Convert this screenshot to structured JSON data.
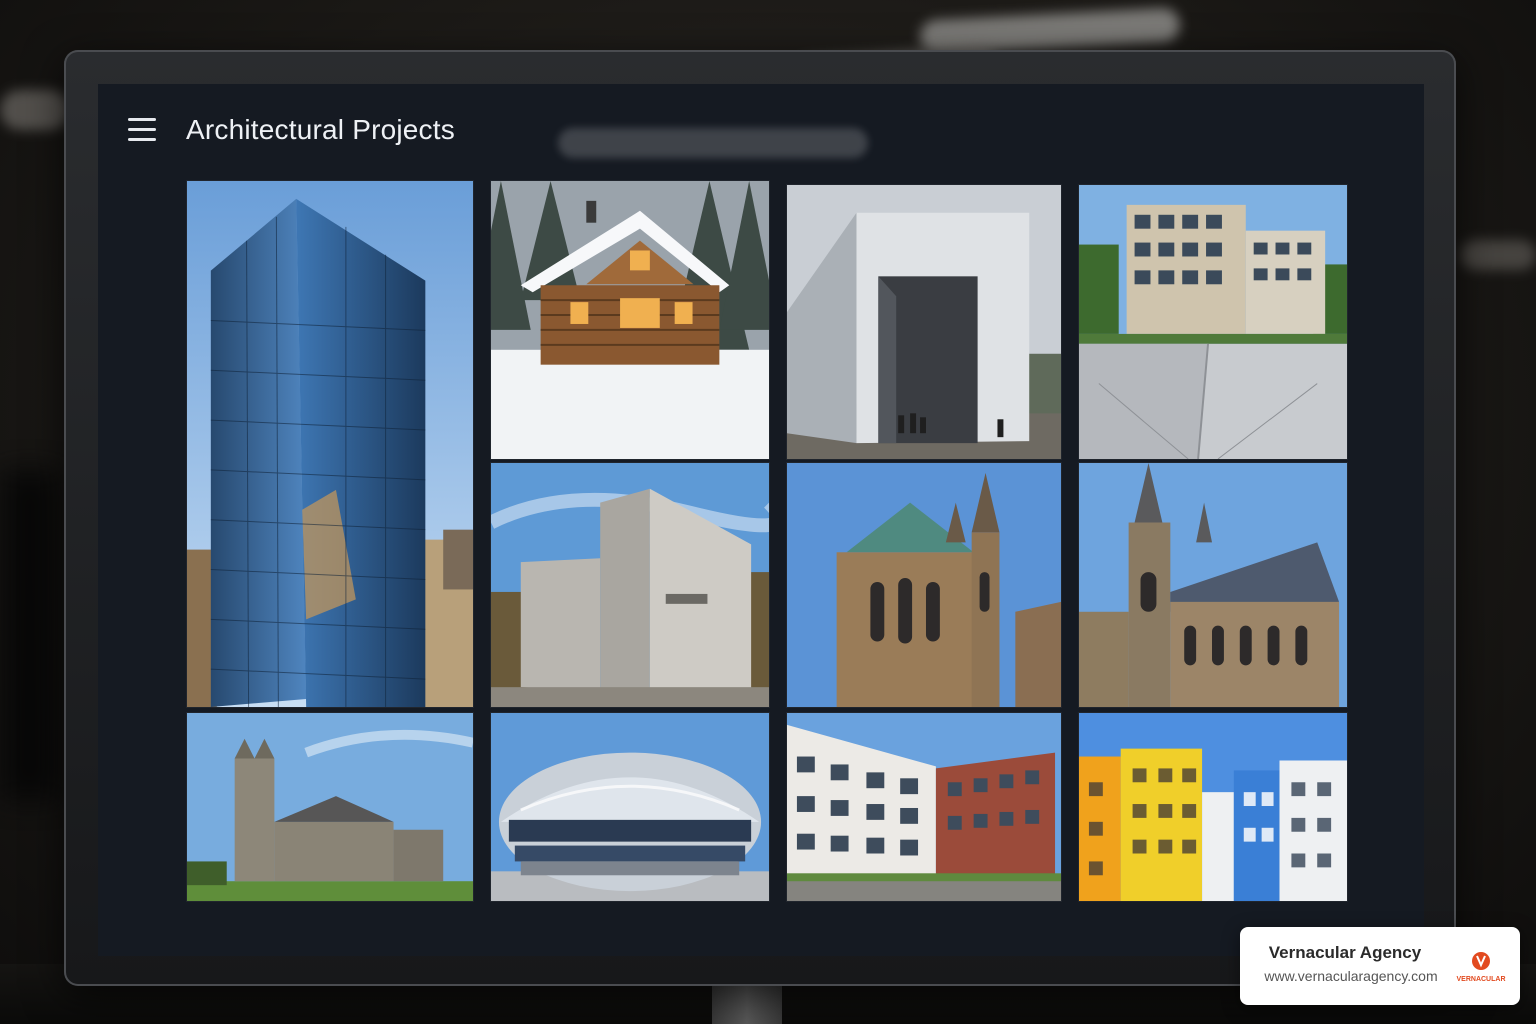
{
  "app": {
    "title": "Architectural Projects",
    "menu_icon": "hamburger-menu-icon"
  },
  "gallery": {
    "tiles": [
      {
        "id": "glass-skyscraper",
        "subject": "glass office tower"
      },
      {
        "id": "log-cabin-snow",
        "subject": "snowy log cabin"
      },
      {
        "id": "concrete-portal",
        "subject": "concrete portal monolith"
      },
      {
        "id": "apartment-blocks",
        "subject": "modern apartment blocks"
      },
      {
        "id": "brutalist-museum",
        "subject": "brutalist concrete museum"
      },
      {
        "id": "gothic-cathedral-apse",
        "subject": "gothic cathedral apse"
      },
      {
        "id": "gothic-cathedral-nave",
        "subject": "gothic cathedral nave"
      },
      {
        "id": "gothic-abbey-lawn",
        "subject": "gothic abbey on lawn"
      },
      {
        "id": "stadium-dome",
        "subject": "curved stadium dome"
      },
      {
        "id": "residential-street",
        "subject": "residential street blocks"
      },
      {
        "id": "colorful-apartments",
        "subject": "colorful apartment facades"
      }
    ]
  },
  "watermark": {
    "name": "Vernacular Agency",
    "url": "www.vernacularagency.com",
    "logo_text": "VERNACULAR",
    "accent_color": "#e24a1f"
  }
}
